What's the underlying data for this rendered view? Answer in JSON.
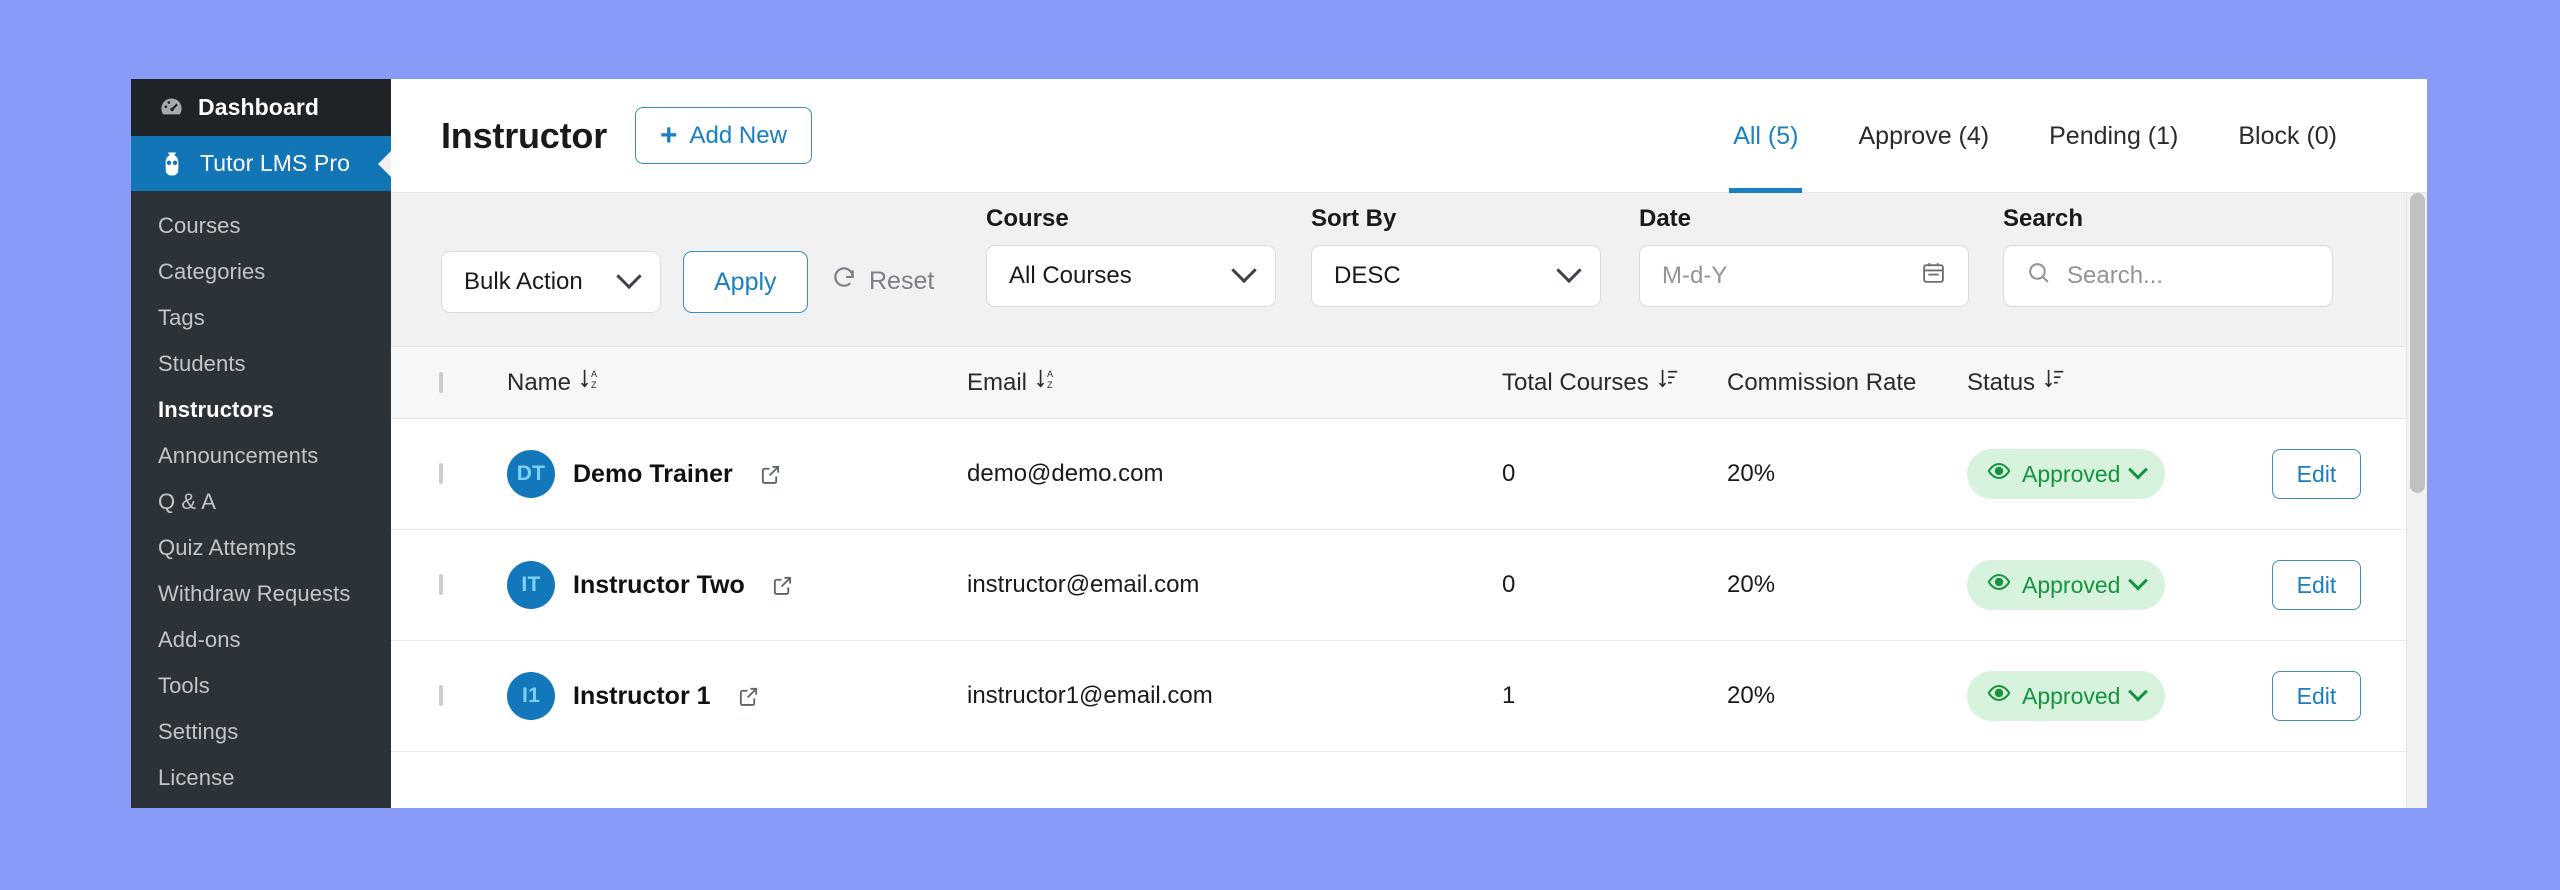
{
  "theme": {
    "page_background": "#879bf7",
    "sidebar_bg": "#2c3338",
    "sidebar_top_bg": "#1d2327",
    "accent_blue": "#1a7fc1",
    "active_item_bg": "#1275b6",
    "badge_green_bg": "#d7f2dd",
    "badge_green_text": "#17933f",
    "avatar_bg": "#1277bb",
    "avatar_text": "#7fd2f5"
  },
  "sidebar": {
    "dashboard": {
      "label": "Dashboard",
      "icon": "gauge-icon"
    },
    "active_plugin": {
      "label": "Tutor LMS Pro",
      "icon": "owl-icon"
    },
    "items": [
      {
        "label": "Courses",
        "current": false
      },
      {
        "label": "Categories",
        "current": false
      },
      {
        "label": "Tags",
        "current": false
      },
      {
        "label": "Students",
        "current": false
      },
      {
        "label": "Instructors",
        "current": true
      },
      {
        "label": "Announcements",
        "current": false
      },
      {
        "label": "Q & A",
        "current": false
      },
      {
        "label": "Quiz Attempts",
        "current": false
      },
      {
        "label": "Withdraw Requests",
        "current": false
      },
      {
        "label": "Add-ons",
        "current": false
      },
      {
        "label": "Tools",
        "current": false
      },
      {
        "label": "Settings",
        "current": false
      },
      {
        "label": "License",
        "current": false
      }
    ]
  },
  "header": {
    "title": "Instructor",
    "add_new_label": "Add New",
    "add_new_icon": "plus-icon",
    "tabs": [
      {
        "label": "All (5)",
        "active": true
      },
      {
        "label": "Approve (4)",
        "active": false
      },
      {
        "label": "Pending (1)",
        "active": false
      },
      {
        "label": "Block (0)",
        "active": false
      }
    ]
  },
  "filters": {
    "bulk_action": {
      "value": "Bulk Action",
      "icon": "chevron-down-icon"
    },
    "apply_label": "Apply",
    "reset_label": "Reset",
    "reset_icon": "refresh-icon",
    "course": {
      "label": "Course",
      "value": "All Courses",
      "icon": "chevron-down-icon"
    },
    "sort_by": {
      "label": "Sort By",
      "value": "DESC",
      "icon": "chevron-down-icon"
    },
    "date": {
      "label": "Date",
      "value": "",
      "placeholder": "M-d-Y",
      "icon": "calendar-icon"
    },
    "search": {
      "label": "Search",
      "value": "",
      "placeholder": "Search...",
      "icon": "search-icon"
    }
  },
  "table": {
    "columns": [
      {
        "key": "check",
        "label": "",
        "sortable": false
      },
      {
        "key": "name",
        "label": "Name",
        "sortable": true,
        "sort_icon": "sort-alpha-desc-icon"
      },
      {
        "key": "email",
        "label": "Email",
        "sortable": true,
        "sort_icon": "sort-alpha-desc-icon"
      },
      {
        "key": "total_courses",
        "label": "Total Courses",
        "sortable": true,
        "sort_icon": "sort-amount-desc-icon"
      },
      {
        "key": "commission_rate",
        "label": "Commission Rate",
        "sortable": false
      },
      {
        "key": "status",
        "label": "Status",
        "sortable": true,
        "sort_icon": "sort-amount-desc-icon"
      },
      {
        "key": "actions",
        "label": "",
        "sortable": false
      }
    ],
    "rows": [
      {
        "initials": "DT",
        "name": "Demo Trainer",
        "link_icon": "external-link-icon",
        "email": "demo@demo.com",
        "total_courses": "0",
        "commission_rate": "20%",
        "status": "Approved",
        "status_icon": "eye-icon",
        "action_label": "Edit"
      },
      {
        "initials": "IT",
        "name": "Instructor Two",
        "link_icon": "external-link-icon",
        "email": "instructor@email.com",
        "total_courses": "0",
        "commission_rate": "20%",
        "status": "Approved",
        "status_icon": "eye-icon",
        "action_label": "Edit"
      },
      {
        "initials": "I1",
        "name": "Instructor 1",
        "link_icon": "external-link-icon",
        "email": "instructor1@email.com",
        "total_courses": "1",
        "commission_rate": "20%",
        "status": "Approved",
        "status_icon": "eye-icon",
        "action_label": "Edit"
      }
    ]
  }
}
